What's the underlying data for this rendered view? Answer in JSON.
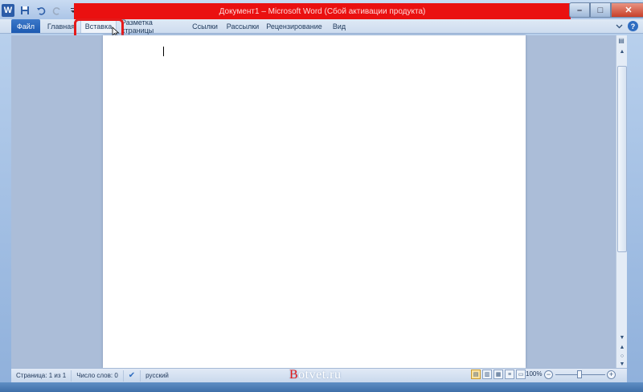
{
  "window": {
    "title": "Документ1  –  Microsoft Word (Сбой активации продукта)",
    "app_icon_letter": "W",
    "controls": {
      "minimize": "–",
      "maximize": "□",
      "close": "✕"
    }
  },
  "quick_access": [
    "save-icon",
    "undo-icon",
    "redo-icon",
    "customize-icon"
  ],
  "ribbon": {
    "tabs": [
      {
        "label": "Файл"
      },
      {
        "label": "Главная"
      },
      {
        "label": "Вставка"
      },
      {
        "label": "Разметка страницы"
      },
      {
        "label": "Ссылки"
      },
      {
        "label": "Рассылки"
      },
      {
        "label": "Рецензирование"
      },
      {
        "label": "Вид"
      }
    ],
    "help": "?"
  },
  "statusbar": {
    "page": "Страница: 1 из 1",
    "words": "Число слов: 0",
    "language": "русский",
    "zoom": "100%"
  },
  "watermark": {
    "first": "B",
    "rest": "otvet.ru"
  },
  "colors": {
    "highlight": "#e51a1a",
    "title_bar": "#ea1010",
    "file_tab": "#2a66bb"
  }
}
